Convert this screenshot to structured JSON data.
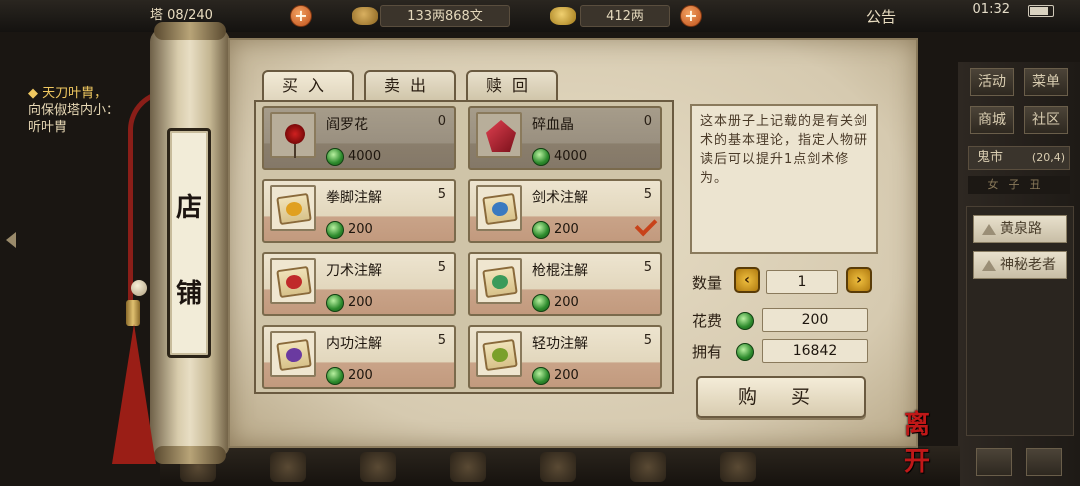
{
  "topbar": {
    "pagoda_label": "塔",
    "pagoda_progress": "08/240",
    "copper": "133两868文",
    "silver": "412两",
    "notice": "公告",
    "clock": "01:32"
  },
  "left_quest": {
    "title": "◆ 天刀叶胄，",
    "line1": "向保俶塔内小：",
    "line2": "听叶胄"
  },
  "right_menu": {
    "buttons": [
      "活动",
      "菜单",
      "商城",
      "社区"
    ],
    "map_name": "鬼市",
    "map_coord": "(20,4)",
    "time_strip": "女子丑",
    "npcs": [
      "黄泉路",
      "神秘老者"
    ]
  },
  "shop": {
    "sign": [
      "店",
      "铺"
    ],
    "tabs": [
      "买入",
      "卖出",
      "赎回"
    ],
    "items": [
      {
        "name": "阎罗花",
        "count": "0",
        "price": "4000",
        "sold_out": true,
        "icon": "red-flower-icon"
      },
      {
        "name": "碎血晶",
        "count": "0",
        "price": "4000",
        "sold_out": true,
        "icon": "blood-crystal-icon"
      },
      {
        "name": "拳脚注解",
        "count": "5",
        "price": "200",
        "sold_out": false,
        "icon": "fist-manual-icon"
      },
      {
        "name": "剑术注解",
        "count": "5",
        "price": "200",
        "sold_out": false,
        "icon": "sword-manual-icon"
      },
      {
        "name": "刀术注解",
        "count": "5",
        "price": "200",
        "sold_out": false,
        "icon": "blade-manual-icon"
      },
      {
        "name": "枪棍注解",
        "count": "5",
        "price": "200",
        "sold_out": false,
        "icon": "spear-manual-icon"
      },
      {
        "name": "内功注解",
        "count": "5",
        "price": "200",
        "sold_out": false,
        "icon": "inner-power-manual-icon"
      },
      {
        "name": "轻功注解",
        "count": "5",
        "price": "200",
        "sold_out": false,
        "icon": "lightness-manual-icon"
      }
    ],
    "selected_item": "剑术注解",
    "description": "这本册子上记载的是有关剑术的基本理论，指定人物研读后可以提升1点剑术修为。",
    "quantity_label": "数量",
    "quantity": "1",
    "cost_label": "花费",
    "cost": "200",
    "owned_label": "拥有",
    "owned": "16842",
    "buy_label": "购 买",
    "leave_label": "离开"
  },
  "colors": {
    "jade": "#2c8a2c",
    "check": "#c8421a",
    "leave": "#c01818"
  }
}
